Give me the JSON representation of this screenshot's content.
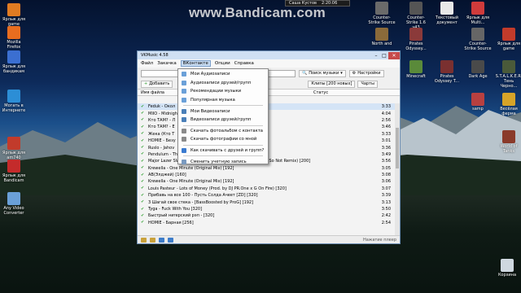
{
  "watermark": "www.Bandicam.com",
  "top_user": {
    "name": "Саша Кустов",
    "time": "2:20:06"
  },
  "desktop_left": [
    {
      "label": "Ярлык для game",
      "icon": "shortcut-icon",
      "color": "#e07b22"
    },
    {
      "label": "Mozilla Firefox",
      "icon": "firefox-icon",
      "color": "#e86d1f"
    },
    {
      "label": "Ярлык для бандикам",
      "icon": "shortcut-icon",
      "color": "#3b6fd1"
    },
    {
      "label": "Могать в Интернете",
      "icon": "globe-icon",
      "color": "#2c8ed6"
    },
    {
      "label": "Ярлык для am740",
      "icon": "shortcut-icon",
      "color": "#c23b2b"
    },
    {
      "label": "Ярлык для Bandicam",
      "icon": "bandicam-icon",
      "color": "#c42b2b"
    },
    {
      "label": "Any Video Converter",
      "icon": "converter-icon",
      "color": "#6aa0d8"
    }
  ],
  "desktop_right": [
    {
      "label": "Counter-Strike Source",
      "icon": "cs-icon",
      "color": "#6a6a6a"
    },
    {
      "label": "Counter-Strike 1.6 v43",
      "icon": "cs-icon",
      "color": "#555"
    },
    {
      "label": "Текстовый документ",
      "icon": "text-document-icon",
      "color": "#e8e8e8"
    },
    {
      "label": "Ярлык для Multi...",
      "icon": "shortcut-icon",
      "color": "#d03b3b"
    },
    {
      "label": "North and",
      "icon": "game-icon",
      "color": "#8a6a3a"
    },
    {
      "label": "Pirates Odyssey...",
      "icon": "game-icon",
      "color": "#8b3a3a"
    },
    {
      "label": "Counter-Strike Source",
      "icon": "cs-icon",
      "color": "#666"
    },
    {
      "label": "Ярлык для game",
      "icon": "shortcut-icon",
      "color": "#c23b2b"
    },
    {
      "label": "Minecraft",
      "icon": "minecraft-icon",
      "color": "#5a8a3a"
    },
    {
      "label": "Pirates Odyssey T...",
      "icon": "game-icon",
      "color": "#7a3030"
    },
    {
      "label": "Dark Age",
      "icon": "game-icon",
      "color": "#4a4a4a"
    },
    {
      "label": "S.T.A.L.K.E.R. Тень Черно...",
      "icon": "game-icon",
      "color": "#4a5a3a"
    },
    {
      "label": "samp",
      "icon": "game-icon",
      "color": "#b84040"
    },
    {
      "label": "Весёлая ферма",
      "icon": "game-icon",
      "color": "#d7a428"
    },
    {
      "label": "World of Tanks",
      "icon": "tank-icon",
      "color": "#8a3a2a"
    },
    {
      "label": "Корзина",
      "icon": "recycle-bin-icon",
      "color": "#cfd8e0"
    }
  ],
  "window": {
    "title": "VKMusic 4.58",
    "menu": [
      "Файл",
      "Закачка",
      "ВКонтакте",
      "Опции",
      "Справка"
    ],
    "search_option": "Поиск музыки",
    "settings_label": "Настройки",
    "add_button": "Добавить",
    "tabs": [
      "Клипы [200 новых]",
      "Чарты"
    ],
    "col_name": "Имя файла",
    "col_status": "Статус",
    "rows": [
      {
        "title": "Feduk - Окол",
        "dur": "3:33"
      },
      {
        "title": "MIIO - Midnigh",
        "dur": "4:04"
      },
      {
        "title": "Кто ТАМ? - Л",
        "dur": "2:56"
      },
      {
        "title": "Кто ТАМ? - Е",
        "dur": "3:46"
      },
      {
        "title": "Жека (Кто Т",
        "dur": "3:33"
      },
      {
        "title": "HOMIE - Безу",
        "dur": "3:01"
      },
      {
        "title": "Ruslo - Jahov",
        "dur": "3:36"
      },
      {
        "title": "Pendulum - Th",
        "dur": "3:49"
      },
      {
        "title": "Major Lazer SWAGGAFOX FILMS - Get Free ft. Amber (What So Not Remix) [200]",
        "dur": "3:56"
      },
      {
        "title": "Krewella - One Minute (Original Mix) [192]",
        "dur": "3:05"
      },
      {
        "title": "АВ(Элджей) [160]",
        "dur": "3:08"
      },
      {
        "title": "Krewella - One Minute (Original Mix) [192]",
        "dur": "3:06"
      },
      {
        "title": "Louis Pasteur - Lots of Money (Prod. by DJ PR.One x G On Fire) [320]",
        "dur": "3:07"
      },
      {
        "title": "Прибавь на все 100 - Пусть Солда Ачеет [ZD] [320]",
        "dur": "3:39"
      },
      {
        "title": "3 Шагай свое стека - [BassBoosted by ProG] [192]",
        "dur": "3:13"
      },
      {
        "title": "Tyga - Fuck With You [320]",
        "dur": "3:50"
      },
      {
        "title": "Быстрый ниrерский рэп - [320]",
        "dur": "2:42"
      },
      {
        "title": "HOMIE - Барная [256]",
        "dur": "2:54"
      }
    ],
    "status_right": "Нажатие плеер"
  },
  "dropdown": [
    {
      "label": "Мои Аудиозаписи",
      "icon": "audio-icon",
      "color": "#6aa0d8"
    },
    {
      "label": "Аудиозаписи друзей/групп",
      "icon": "audio-friends-icon",
      "color": "#6aa0d8"
    },
    {
      "label": "Рекомендации музыки",
      "icon": "recommend-icon",
      "color": "#6aa0d8"
    },
    {
      "label": "Популярная музыка",
      "icon": "popular-icon",
      "color": "#6aa0d8"
    },
    {
      "label": "Мои Видеозаписи",
      "icon": "video-icon",
      "color": "#4a7fb8"
    },
    {
      "label": "Видеозаписи друзей/групп",
      "icon": "video-friends-icon",
      "color": "#4a7fb8"
    },
    {
      "label": "Скачать фотоальбом с контакта",
      "icon": "photo-icon",
      "color": "#8a8a8a"
    },
    {
      "label": "Скачать фотографии со мной",
      "icon": "photo-icon",
      "color": "#8a8a8a"
    },
    {
      "label": "Как скачивать с друзей и групп?",
      "icon": "help-icon",
      "color": "#3a7ad0"
    },
    {
      "label": "Сменить учетную запись",
      "icon": "user-icon",
      "color": "#7a9ac0"
    }
  ]
}
